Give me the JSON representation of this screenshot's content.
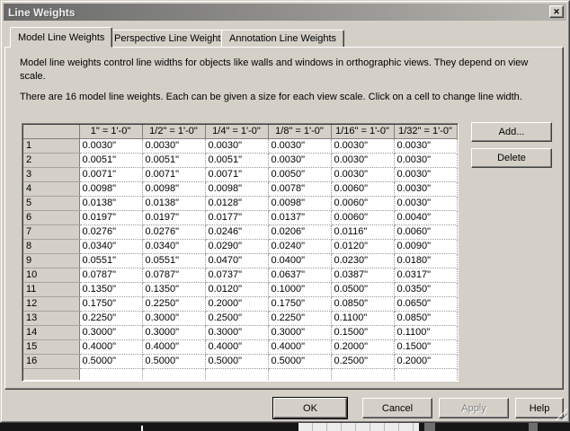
{
  "window": {
    "title": "Line Weights",
    "close_glyph": "✕"
  },
  "tabs": [
    {
      "label": "Model Line Weights",
      "active": true
    },
    {
      "label": "Perspective Line Weights",
      "active": false
    },
    {
      "label": "Annotation Line Weights",
      "active": false
    }
  ],
  "description": {
    "para1": "Model line weights control line widths for objects like walls and windows in orthographic views. They depend on view scale.",
    "para2": "There are 16 model line weights. Each can be given a size for each view scale. Click on a cell to change line width."
  },
  "table": {
    "col_headers": [
      "1\" = 1'-0\"",
      "1/2\" = 1'-0\"",
      "1/4\" = 1'-0\"",
      "1/8\" = 1'-0\"",
      "1/16\" = 1'-0\"",
      "1/32\" = 1'-0\""
    ],
    "rows": [
      {
        "id": "1",
        "values": [
          "0.0030\"",
          "0.0030\"",
          "0.0030\"",
          "0.0030\"",
          "0.0030\"",
          "0.0030\""
        ]
      },
      {
        "id": "2",
        "values": [
          "0.0051\"",
          "0.0051\"",
          "0.0051\"",
          "0.0030\"",
          "0.0030\"",
          "0.0030\""
        ]
      },
      {
        "id": "3",
        "values": [
          "0.0071\"",
          "0.0071\"",
          "0.0071\"",
          "0.0050\"",
          "0.0030\"",
          "0.0030\""
        ]
      },
      {
        "id": "4",
        "values": [
          "0.0098\"",
          "0.0098\"",
          "0.0098\"",
          "0.0078\"",
          "0.0060\"",
          "0.0030\""
        ]
      },
      {
        "id": "5",
        "values": [
          "0.0138\"",
          "0.0138\"",
          "0.0128\"",
          "0.0098\"",
          "0.0060\"",
          "0.0030\""
        ]
      },
      {
        "id": "6",
        "values": [
          "0.0197\"",
          "0.0197\"",
          "0.0177\"",
          "0.0137\"",
          "0.0060\"",
          "0.0040\""
        ]
      },
      {
        "id": "7",
        "values": [
          "0.0276\"",
          "0.0276\"",
          "0.0246\"",
          "0.0206\"",
          "0.0116\"",
          "0.0060\""
        ]
      },
      {
        "id": "8",
        "values": [
          "0.0340\"",
          "0.0340\"",
          "0.0290\"",
          "0.0240\"",
          "0.0120\"",
          "0.0090\""
        ]
      },
      {
        "id": "9",
        "values": [
          "0.0551\"",
          "0.0551\"",
          "0.0470\"",
          "0.0400\"",
          "0.0230\"",
          "0.0180\""
        ]
      },
      {
        "id": "10",
        "values": [
          "0.0787\"",
          "0.0787\"",
          "0.0737\"",
          "0.0637\"",
          "0.0387\"",
          "0.0317\""
        ]
      },
      {
        "id": "11",
        "values": [
          "0.1350\"",
          "0.1350\"",
          "0.0120\"",
          "0.1000\"",
          "0.0500\"",
          "0.0350\""
        ]
      },
      {
        "id": "12",
        "values": [
          "0.1750\"",
          "0.2250\"",
          "0.2000\"",
          "0.1750\"",
          "0.0850\"",
          "0.0650\""
        ]
      },
      {
        "id": "13",
        "values": [
          "0.2250\"",
          "0.3000\"",
          "0.2500\"",
          "0.2250\"",
          "0.1100\"",
          "0.0850\""
        ]
      },
      {
        "id": "14",
        "values": [
          "0.3000\"",
          "0.3000\"",
          "0.3000\"",
          "0.3000\"",
          "0.1500\"",
          "0.1100\""
        ]
      },
      {
        "id": "15",
        "values": [
          "0.4000\"",
          "0.4000\"",
          "0.4000\"",
          "0.4000\"",
          "0.2000\"",
          "0.1500\""
        ]
      },
      {
        "id": "16",
        "values": [
          "0.5000\"",
          "0.5000\"",
          "0.5000\"",
          "0.5000\"",
          "0.2500\"",
          "0.2000\""
        ]
      }
    ]
  },
  "side_buttons": {
    "add": "Add...",
    "delete": "Delete"
  },
  "bottom_buttons": {
    "ok": "OK",
    "cancel": "Cancel",
    "apply": "Apply",
    "help": "Help"
  }
}
